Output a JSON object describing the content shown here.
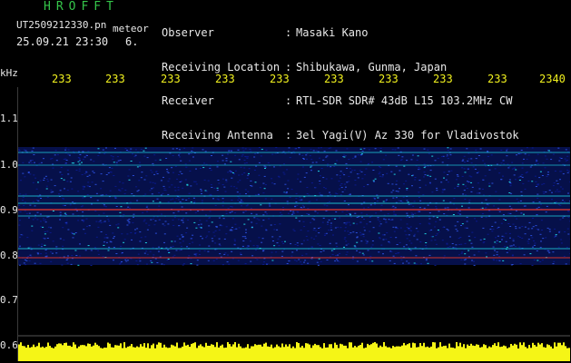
{
  "header": {
    "app_title": "HROFFT",
    "file_name": "UT2509212330.pn",
    "file_tag": "meteor",
    "date_time": "25.09.21 23:30",
    "count": "6."
  },
  "info": [
    {
      "label": "Observer",
      "value": "Masaki Kano"
    },
    {
      "label": "Receiving Location",
      "value": "Shibukawa, Gunma, Japan"
    },
    {
      "label": "Receiver",
      "value": "RTL-SDR SDR# 43dB L15 103.2MHz CW"
    },
    {
      "label": "Receiving Antenna",
      "value": "3el Yagi(V) Az 330 for Vladivostok"
    }
  ],
  "info_colon": ":",
  "axis": {
    "unit": "kHz",
    "y_ticks": [
      "1.1",
      "1.0",
      "0.9",
      "0.8",
      "0.7",
      "0.6"
    ],
    "x_ticks": [
      "233",
      "233",
      "233",
      "233",
      "233",
      "233",
      "233",
      "233",
      "233",
      "2340"
    ]
  },
  "colors": {
    "background": "#000000",
    "signal_low": "#0a1a8c",
    "signal_mid": "#1fd0e0",
    "signal_high": "#e83a2a",
    "power_bar": "#f5f516",
    "text_white": "#e8e8e8",
    "title_green": "#35c64a",
    "axis_yellow": "#f1f11e"
  }
}
